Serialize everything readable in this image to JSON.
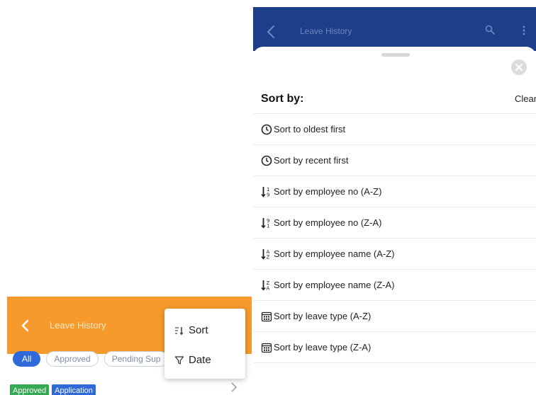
{
  "left": {
    "title": "Leave History",
    "filters": [
      "All",
      "Approved",
      "Pending Sup"
    ],
    "badges": [
      "Approved",
      "Application"
    ],
    "menu": {
      "sort_label": "Sort",
      "date_label": "Date"
    },
    "colors": {
      "header": "#f59a2b",
      "accent": "#2f6ad8"
    }
  },
  "right": {
    "title": "Leave History",
    "sort_title": "Sort by:",
    "clear_label": "Clear",
    "options": [
      {
        "label": "Sort to oldest first",
        "icon": "clock-icon"
      },
      {
        "label": "Sort by recent first",
        "icon": "clock-icon"
      },
      {
        "label": "Sort by employee no (A-Z)",
        "icon": "sort-numeric-asc-icon"
      },
      {
        "label": "Sort by employee no (Z-A)",
        "icon": "sort-numeric-desc-icon"
      },
      {
        "label": "Sort by employee name (A-Z)",
        "icon": "sort-alpha-asc-icon"
      },
      {
        "label": "Sort by employee name (Z-A)",
        "icon": "sort-alpha-desc-icon"
      },
      {
        "label": "Sort by leave type (A-Z)",
        "icon": "calendar-icon"
      },
      {
        "label": "Sort by leave type (Z-A)",
        "icon": "calendar-icon"
      }
    ],
    "colors": {
      "header": "#1d3f8a"
    }
  }
}
